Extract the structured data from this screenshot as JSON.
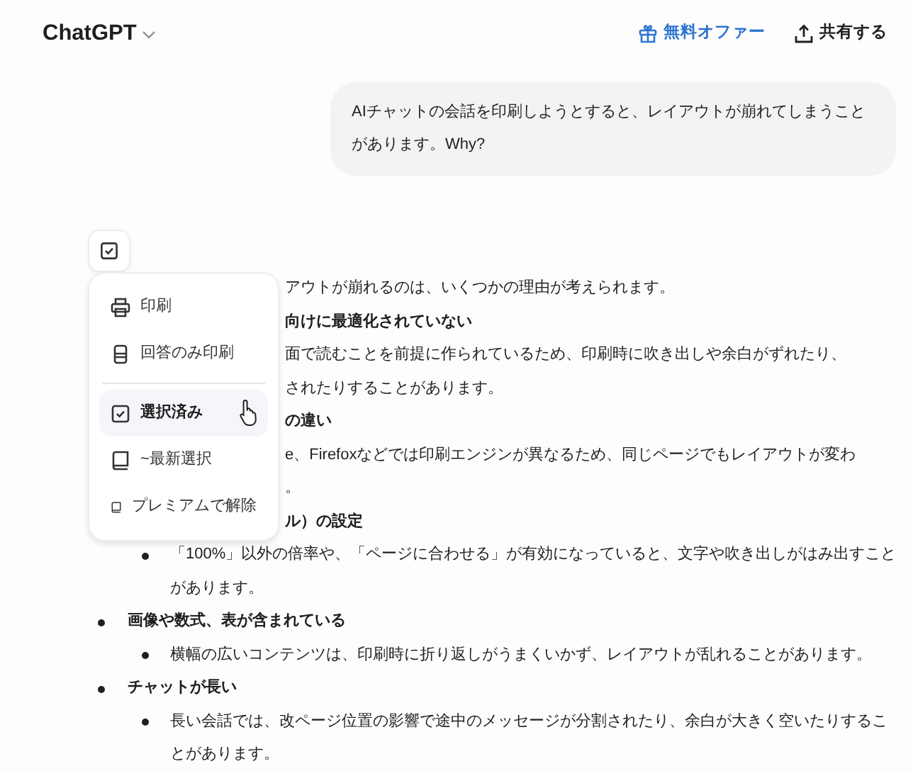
{
  "header": {
    "title": "ChatGPT",
    "offer": "無料オファー",
    "share": "共有する"
  },
  "user_message": "AIチャットの会話を印刷しようとすると、レイアウトが崩れてしまうことがあります。Why?",
  "select_toggle": {
    "checked": true
  },
  "menu": [
    {
      "kind": "printer",
      "label": "印刷",
      "selected": false,
      "divider_before": false
    },
    {
      "kind": "receipt",
      "label": "回答のみ印刷",
      "selected": false,
      "divider_before": false
    },
    {
      "kind": "check",
      "label": "選択済み",
      "selected": true,
      "divider_before": true
    },
    {
      "kind": "book",
      "label": "~最新選択",
      "selected": false,
      "divider_before": false
    },
    {
      "kind": "book",
      "label": "プレミアムで解除",
      "selected": false,
      "divider_before": false
    }
  ],
  "answer_fragments": [
    {
      "kind": "text",
      "text": "アウトが崩れるのは、いくつかの理由が考えられます。"
    },
    {
      "kind": "heading",
      "text": "向けに最適化されていない"
    },
    {
      "kind": "text",
      "text": "面で読むことを前提に作られているため、印刷時に吹き出しや余白がずれたり、"
    },
    {
      "kind": "text",
      "text": "されたりすることがあります。"
    },
    {
      "kind": "heading",
      "text": "の違い"
    },
    {
      "kind": "text",
      "text": "e、Firefoxなどでは印刷エンジンが異なるため、同じページでもレイアウトが変わ"
    },
    {
      "kind": "text",
      "text": "。"
    },
    {
      "kind": "heading",
      "text": "ル）の設定"
    }
  ],
  "sections": [
    {
      "bulleted": false,
      "points": [
        "「100%」以外の倍率や、「ページに合わせる」が有効になっていると、文字や吹き出しがはみ出すことがあります。"
      ]
    },
    {
      "title": "画像や数式、表が含まれている",
      "bulleted": true,
      "points": [
        "横幅の広いコンテンツは、印刷時に折り返しがうまくいかず、レイアウトが乱れることがあります。"
      ]
    },
    {
      "title": "チャットが長い",
      "bulleted": true,
      "points": [
        "長い会話では、改ページ位置の影響で途中のメッセージが分割されたり、余白が大きく空いたりすることがあります。"
      ]
    }
  ]
}
